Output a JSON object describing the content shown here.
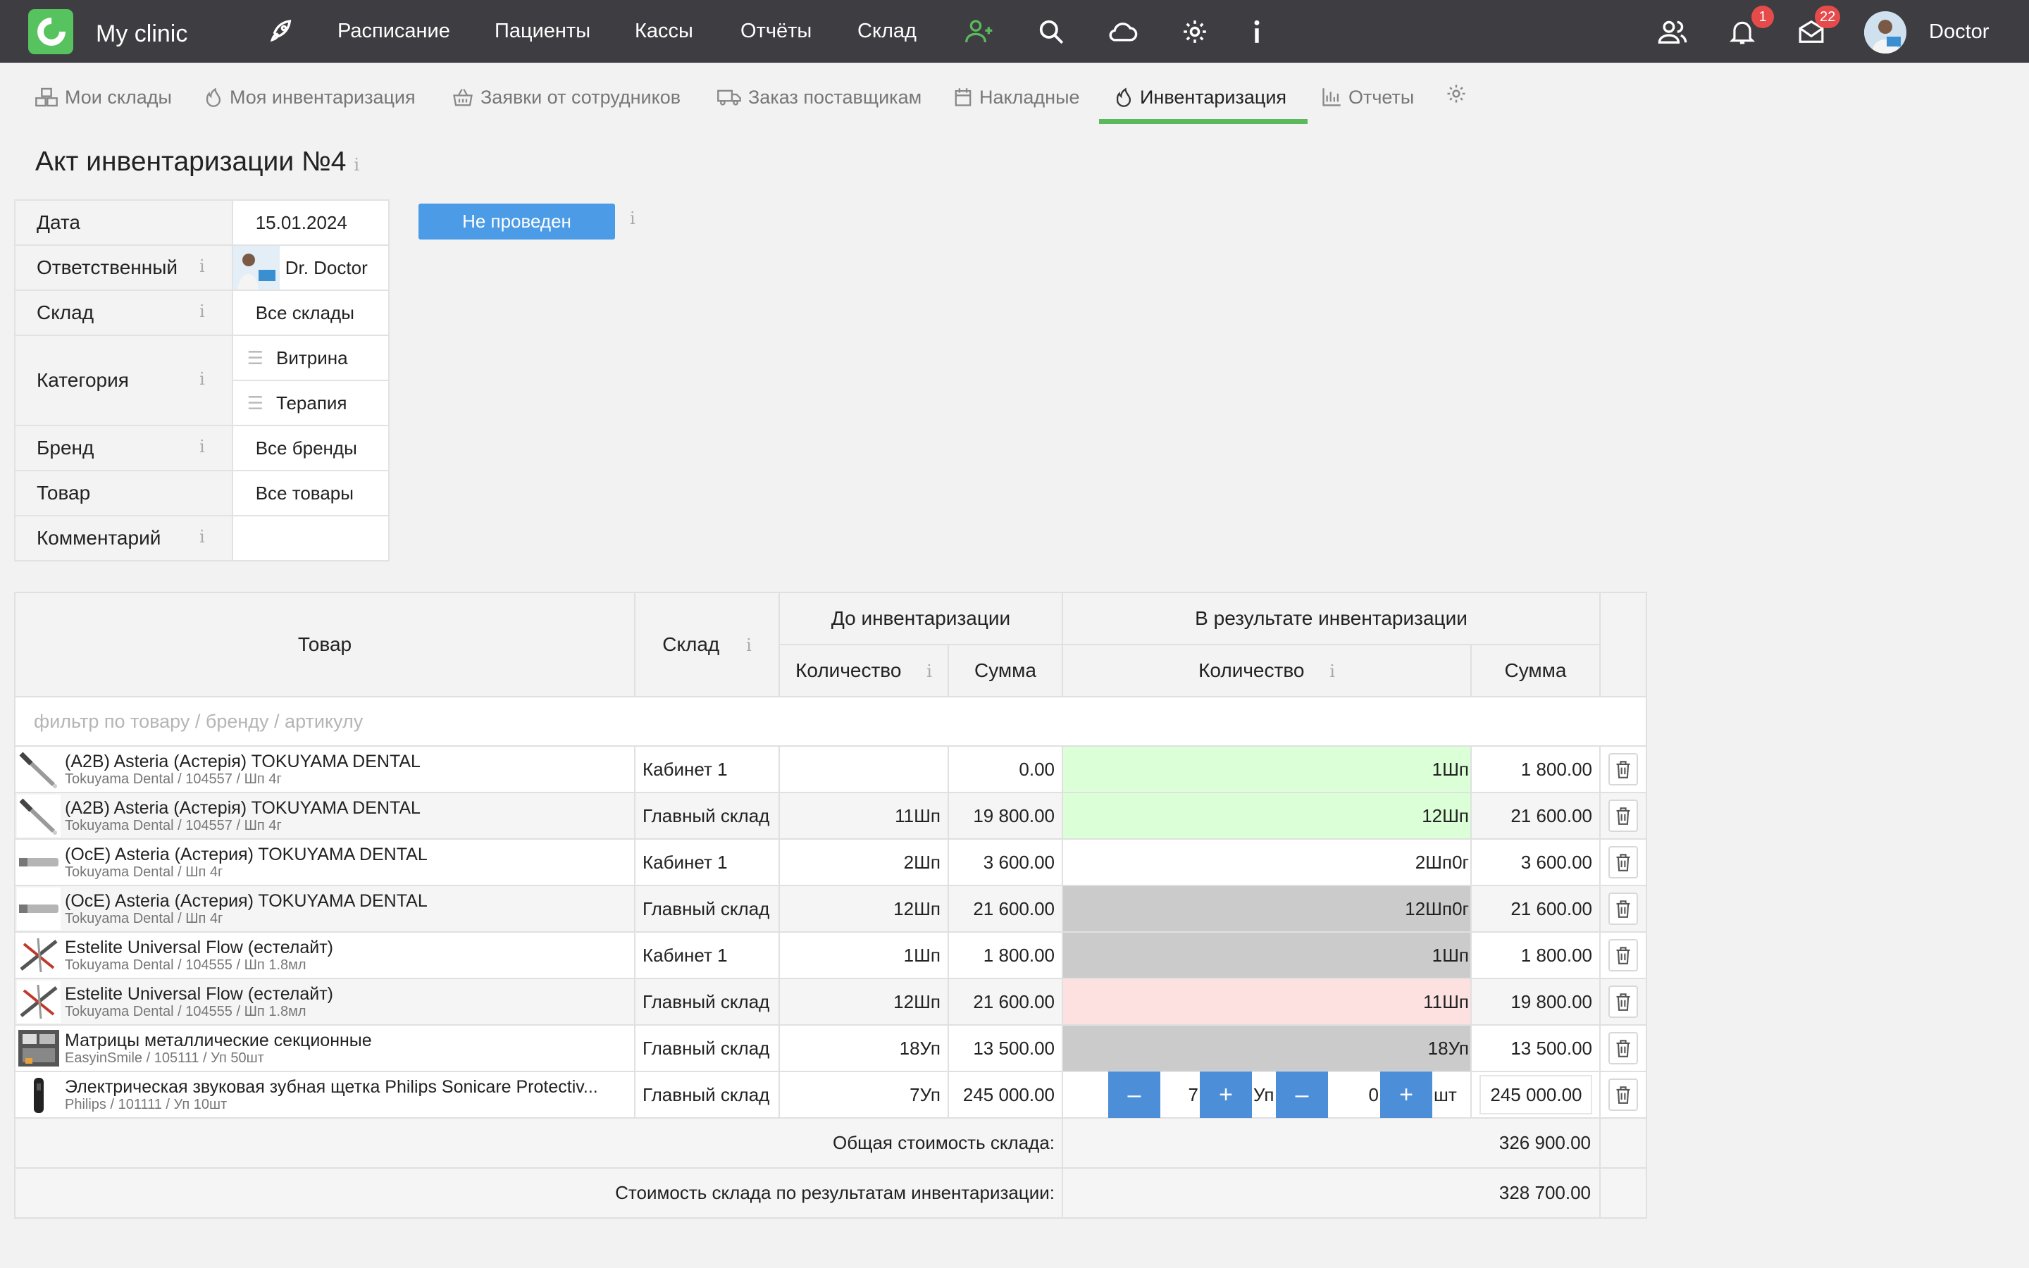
{
  "header": {
    "app_title": "My clinic",
    "nav": [
      "Расписание",
      "Пациенты",
      "Кассы",
      "Отчёты",
      "Склад"
    ],
    "notifications_count": "1",
    "messages_count": "22",
    "user_name": "Doctor",
    "icons": [
      "rocket-icon",
      "add-user-icon",
      "search-icon",
      "cloud-icon",
      "gear-icon",
      "info-icon",
      "users-icon",
      "bell-icon",
      "mail-icon"
    ]
  },
  "subnav": {
    "items": [
      "Мои склады",
      "Моя инвентаризация",
      "Заявки от сотрудников",
      "Заказ поставщикам",
      "Накладные",
      "Инвентаризация",
      "Отчеты"
    ],
    "active": "Инвентаризация"
  },
  "page": {
    "title": "Акт инвентаризации №4",
    "status": "Не проведен"
  },
  "info": {
    "date_label": "Дата",
    "date_value": "15.01.2024",
    "responsible_label": "Ответственный",
    "responsible_value": "Dr. Doctor",
    "warehouse_label": "Склад",
    "warehouse_value": "Все склады",
    "category_label": "Категория",
    "categories": [
      "Витрина",
      "Терапия"
    ],
    "brand_label": "Бренд",
    "brand_value": "Все бренды",
    "product_label": "Товар",
    "product_value": "Все товары",
    "comment_label": "Комментарий",
    "comment_value": ""
  },
  "table": {
    "col_product": "Товар",
    "col_warehouse": "Склад",
    "group_before": "До инвентаризации",
    "group_after": "В результате инвентаризации",
    "col_qty": "Количество",
    "col_sum": "Сумма",
    "filter_placeholder": "фильтр по товару / бренду / артикулу",
    "rows": [
      {
        "name": "(A2B) Asteria (Астерія) TOKUYAMA DENTAL",
        "sub": "Tokuyama Dental  /  104557  /  Шп 4г",
        "warehouse": "Кабинет 1",
        "qty_before": "",
        "sum_before": "0.00",
        "qty_after": "1Шп",
        "sum_after": "1 800.00",
        "state": "green",
        "thumb": "syringe"
      },
      {
        "name": "(A2B) Asteria (Астерія) TOKUYAMA DENTAL",
        "sub": "Tokuyama Dental  /  104557  /  Шп 4г",
        "warehouse": "Главный склад",
        "qty_before": "11Шп",
        "sum_before": "19 800.00",
        "qty_after": "12Шп",
        "sum_after": "21 600.00",
        "state": "green",
        "thumb": "syringe"
      },
      {
        "name": "(OcE) Asteria (Астерия) TOKUYAMA DENTAL",
        "sub": "Tokuyama Dental  /  Шп 4г",
        "warehouse": "Кабинет 1",
        "qty_before": "2Шп",
        "sum_before": "3 600.00",
        "qty_after": "2Шп0г",
        "sum_after": "3 600.00",
        "state": "none",
        "thumb": "tube"
      },
      {
        "name": "(OcE) Asteria (Астерия) TOKUYAMA DENTAL",
        "sub": "Tokuyama Dental  /  Шп 4г",
        "warehouse": "Главный склад",
        "qty_before": "12Шп",
        "sum_before": "21 600.00",
        "qty_after": "12Шп0г",
        "sum_after": "21 600.00",
        "state": "gray",
        "thumb": "tube"
      },
      {
        "name": "Estelite Universal Flow (естелайт)",
        "sub": "Tokuyama Dental  /  104555  /  Шп 1.8мл",
        "warehouse": "Кабинет 1",
        "qty_before": "1Шп",
        "sum_before": "1 800.00",
        "qty_after": "1Шп",
        "sum_after": "1 800.00",
        "state": "gray",
        "thumb": "cross"
      },
      {
        "name": "Estelite Universal Flow (естелайт)",
        "sub": "Tokuyama Dental  /  104555  /  Шп 1.8мл",
        "warehouse": "Главный склад",
        "qty_before": "12Шп",
        "sum_before": "21 600.00",
        "qty_after": "11Шп",
        "sum_after": "19 800.00",
        "state": "pink",
        "thumb": "cross"
      },
      {
        "name": "Матрицы металлические секционные",
        "sub": "EasyinSmile  /  105111  /  Уп 50шт",
        "warehouse": "Главный склад",
        "qty_before": "18Уп",
        "sum_before": "13 500.00",
        "qty_after": "18Уп",
        "sum_after": "13 500.00",
        "state": "gray",
        "thumb": "box"
      }
    ],
    "edit_row": {
      "name": "Электрическая звуковая зубная щетка Philips Sonicare Protectiv...",
      "sub": "Philips  /  101111  /  Уп 10шт",
      "warehouse": "Главный склад",
      "qty_before": "7Уп",
      "sum_before": "245 000.00",
      "qty_main": "7",
      "unit_main": "Уп",
      "qty_sub": "0",
      "unit_sub": "шт",
      "sum_after": "245 000.00",
      "minus": "–",
      "plus": "+"
    },
    "total_label": "Общая стоимость склада:",
    "total_value": "326 900.00",
    "result_label": "Стоимость склада по результатам инвентаризации:",
    "result_value": "328 700.00"
  }
}
